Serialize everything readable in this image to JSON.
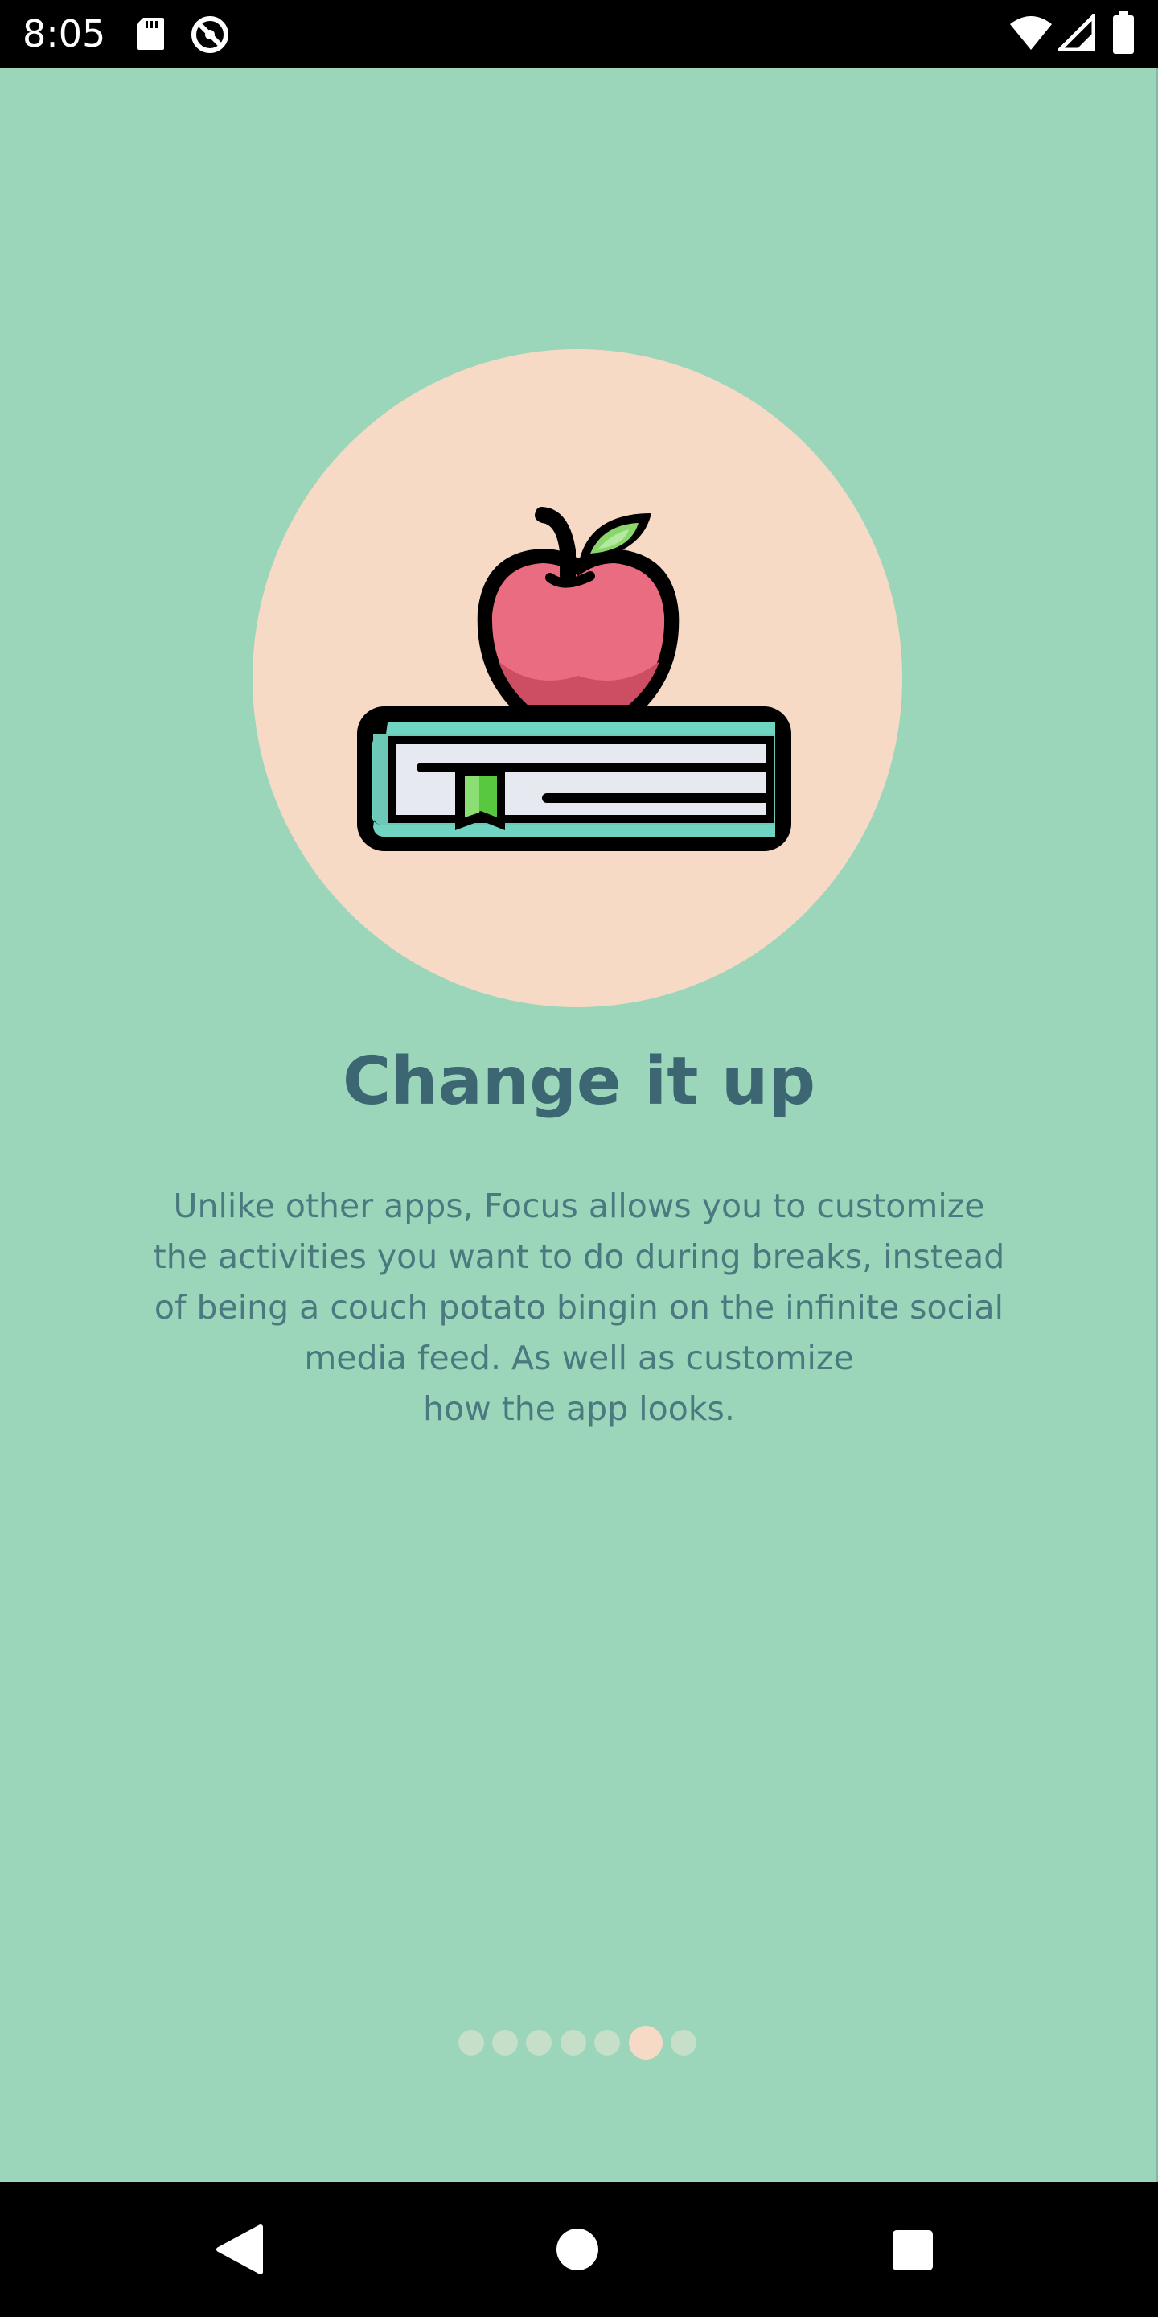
{
  "status_bar": {
    "time": "8:05",
    "icons": [
      "sd-card-icon",
      "no-disturb-icon",
      "wifi-icon",
      "cell-signal-icon",
      "battery-icon"
    ]
  },
  "onboarding": {
    "illustration": "apple-on-book-icon",
    "title": "Change it up",
    "description_lines": [
      "Unlike other apps, Focus allows you to customize",
      "the activities you want to do during breaks, instead",
      "of being a couch potato bingin on the infinite social",
      "media feed. As well as customize",
      "how the app looks."
    ],
    "pager": {
      "total_pages": 7,
      "active_page": 6
    }
  },
  "nav_bar": {
    "buttons": [
      "back-icon",
      "home-icon",
      "recents-icon"
    ]
  },
  "colors": {
    "background": "#9bd6bb",
    "circle": "#f7dac6",
    "title": "#3b6672",
    "body_text": "#4a7a80",
    "dot_inactive": "#c5dfc8",
    "dot_active": "#f7dac6"
  }
}
